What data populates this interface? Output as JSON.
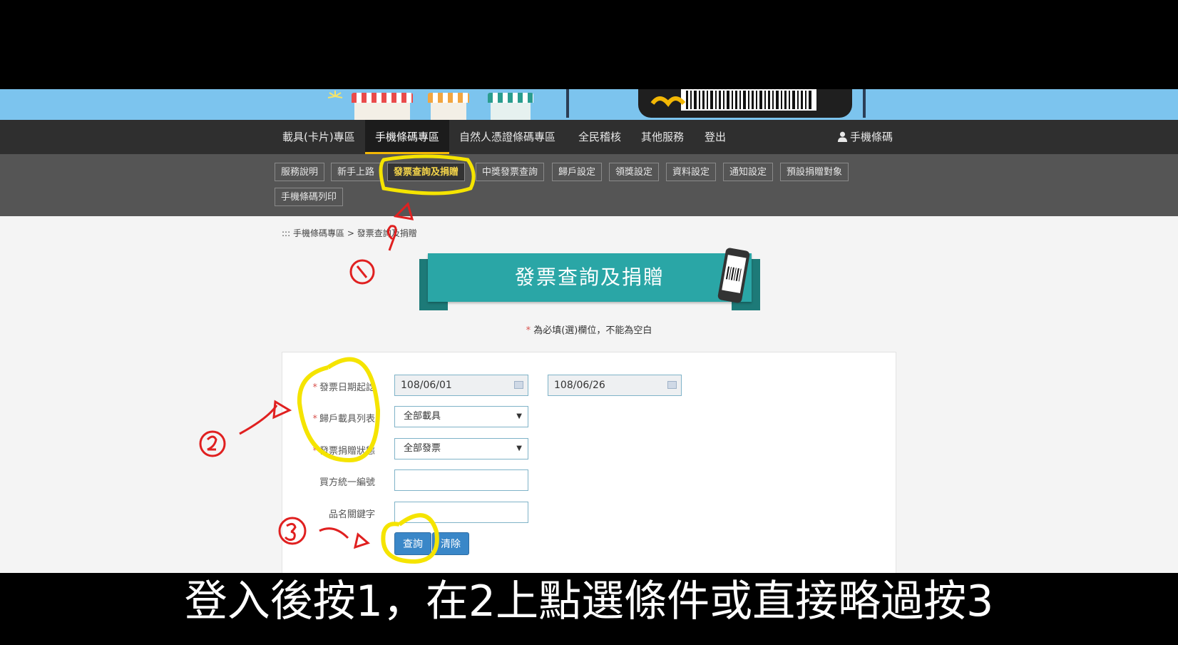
{
  "main_nav": {
    "items": [
      {
        "label": "載具(卡片)專區"
      },
      {
        "label": "手機條碼專區",
        "active": true
      },
      {
        "label": "自然人憑證條碼專區"
      },
      {
        "label": "全民稽核"
      },
      {
        "label": "其他服務"
      },
      {
        "label": "登出"
      }
    ],
    "user_label": "手機條碼",
    "user_icon": "user-icon"
  },
  "sub_nav": {
    "items": [
      {
        "label": "服務說明"
      },
      {
        "label": "新手上路"
      },
      {
        "label": "發票查詢及捐贈",
        "active": true
      },
      {
        "label": "中獎發票查詢"
      },
      {
        "label": "歸戶設定"
      },
      {
        "label": "領獎設定"
      },
      {
        "label": "資料設定"
      },
      {
        "label": "通知設定"
      },
      {
        "label": "預設捐贈對象"
      },
      {
        "label": "手機條碼列印"
      }
    ]
  },
  "breadcrumb": {
    "prefix": ":::",
    "parent": "手機條碼專區",
    "separator": ">",
    "current": "發票查詢及捐贈"
  },
  "page": {
    "title": "發票查詢及捐贈",
    "required_note_star": "*",
    "required_note": "為必填(選)欄位，不能為空白"
  },
  "form": {
    "date_label": "發票日期起訖",
    "date_start": "108/06/01",
    "date_end": "108/06/26",
    "carrier_label": "歸戶載具列表",
    "carrier_selected": "全部載具",
    "status_label": "發票捐贈狀態",
    "status_selected": "全部發票",
    "buyer_id_label": "買方統一編號",
    "buyer_id_value": "",
    "keyword_label": "品名關鍵字",
    "keyword_value": "",
    "required_star": "*",
    "query_button": "查詢",
    "clear_button": "清除"
  },
  "annotations": {
    "colors": {
      "red": "#e02020",
      "yellow": "#f5e400"
    }
  },
  "subtitle": "登入後按1，在2上點選條件或直接略過按3",
  "colors": {
    "nav_bg": "#2f2f2f",
    "subnav_bg": "#555555",
    "accent_yellow": "#f2b705",
    "banner_teal": "#2aa6a6",
    "button_blue": "#3a87c8"
  }
}
